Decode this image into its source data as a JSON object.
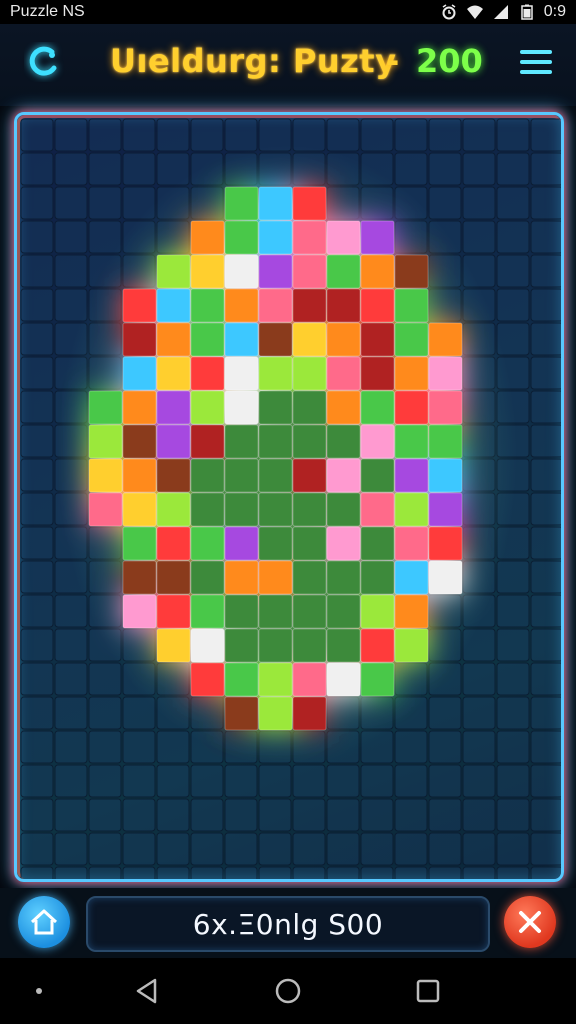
{
  "status_bar": {
    "app_name": "Puzzle NS",
    "time": "0:9",
    "icons": [
      "alarm-icon",
      "wifi-icon",
      "signal-icon",
      "battery-icon"
    ]
  },
  "header": {
    "title": "Uıeldurg: Puzty",
    "separator": "-",
    "score": "200",
    "refresh_icon": "refresh-icon",
    "menu_icon": "hamburger-menu-icon"
  },
  "board": {
    "description_colors": {
      "frame_glow": "#58c8ff",
      "frame_accent": "#ff5a5a",
      "board_bg": "#0f2a48",
      "center_green": "#3e8a3a"
    },
    "palette": [
      "#ff6a8a",
      "#ff3a3a",
      "#ff8a1a",
      "#ffcf2e",
      "#9be83a",
      "#48c84a",
      "#3ec8ff",
      "#a64ae0",
      "#8a3a1a",
      "#f0f0f0",
      "#ff9ad0",
      "#b02020"
    ]
  },
  "bottom_bar": {
    "home_icon": "home-icon",
    "status_text": "6x.Ξ0nlg S00",
    "close_icon": "close-icon"
  },
  "nav_bar": {
    "items": [
      "dot-icon",
      "back-triangle-icon",
      "home-circle-icon",
      "recents-square-icon"
    ]
  }
}
